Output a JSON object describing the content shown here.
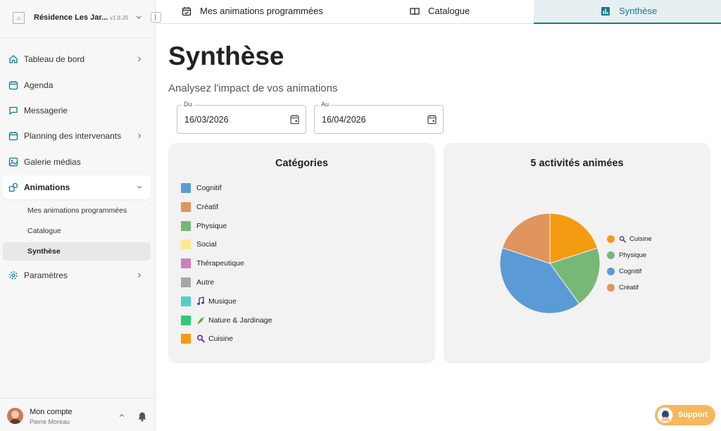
{
  "organization": {
    "name": "Résidence Les Jar...",
    "version": "v1.8.26"
  },
  "sidebar": {
    "items": [
      {
        "label": "Tableau de bord",
        "icon": "home-icon",
        "has_chevron": true
      },
      {
        "label": "Agenda",
        "icon": "calendar-icon",
        "has_chevron": false
      },
      {
        "label": "Messagerie",
        "icon": "chat-icon",
        "has_chevron": false
      },
      {
        "label": "Planning des intervenants",
        "icon": "calendar-icon",
        "has_chevron": true
      },
      {
        "label": "Galerie médias",
        "icon": "image-icon",
        "has_chevron": false
      },
      {
        "label": "Animations",
        "icon": "shapes-icon",
        "has_chevron": true,
        "expanded": true,
        "active": true
      },
      {
        "label": "Paramètres",
        "icon": "gear-icon",
        "has_chevron": true
      }
    ],
    "sub_items": [
      {
        "label": "Mes animations programmées"
      },
      {
        "label": "Catalogue"
      },
      {
        "label": "Synthèse",
        "active": true
      }
    ]
  },
  "account": {
    "title": "Mon compte",
    "user": "Pierre Moreau"
  },
  "tabs": [
    {
      "label": "Mes animations programmées",
      "icon": "calendar-check-icon"
    },
    {
      "label": "Catalogue",
      "icon": "book-icon"
    },
    {
      "label": "Synthèse",
      "icon": "bar-chart-icon",
      "active": true
    }
  ],
  "page": {
    "title": "Synthèse",
    "subtitle": "Analysez l'impact de vos animations"
  },
  "filters": {
    "from": {
      "label": "Du",
      "value": "16/03/2026"
    },
    "to": {
      "label": "Au",
      "value": "16/04/2026"
    }
  },
  "categories_card": {
    "title": "Catégories",
    "items": [
      {
        "label": "Cognitif",
        "color": "#5b9bd5"
      },
      {
        "label": "Créatif",
        "color": "#e0955c"
      },
      {
        "label": "Physique",
        "color": "#77b877"
      },
      {
        "label": "Social",
        "color": "#fbe98d"
      },
      {
        "label": "Thérapeutique",
        "color": "#cf7dc0"
      },
      {
        "label": "Autre",
        "color": "#a6a6a6"
      },
      {
        "label": "Musique",
        "color": "#4fcfc6",
        "emoji": "music-note-icon"
      },
      {
        "label": "Nature & Jardinage",
        "color": "#2ecc71",
        "emoji": "leaf-icon"
      },
      {
        "label": "Cuisine",
        "color": "#f39c12",
        "emoji": "magnifier-icon"
      }
    ]
  },
  "activities_card": {
    "title": "5 activités animées"
  },
  "chart_data": {
    "type": "pie",
    "title": "5 activités animées",
    "slices": [
      {
        "label": "Cuisine",
        "value": 1,
        "color": "#f39c12",
        "emoji": "magnifier-icon"
      },
      {
        "label": "Physique",
        "value": 1,
        "color": "#77b877"
      },
      {
        "label": "Cognitif",
        "value": 2,
        "color": "#5b9bd5"
      },
      {
        "label": "Créatif",
        "value": 1,
        "color": "#e0955c"
      }
    ],
    "legend_position": "right"
  },
  "support": {
    "label": "Support"
  },
  "colors": {
    "accent": "#147a8a",
    "support": "#f6b75d"
  }
}
